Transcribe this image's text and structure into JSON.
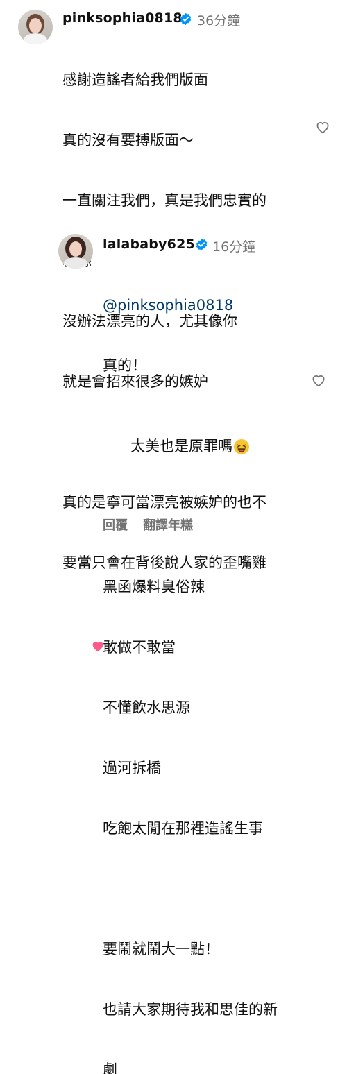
{
  "comment": {
    "username": "pinksophia0818",
    "time": "36分鐘",
    "lines": [
      "感謝造謠者給我們版面",
      "真的沒有要搏版面～",
      "一直關注我們，真是我們忠實的",
      "粉絲",
      "沒辦法漂亮的人，尤其像你",
      "就是會招來很多的嫉妒",
      "",
      "真的是寧可當漂亮被嫉妒的也不",
      "要當只會在背後說人家的歪嘴雞"
    ],
    "end_emoji": "pink-heart-emoji"
  },
  "reply": {
    "username": "lalababy625",
    "time": "16分鐘",
    "mention": "@pinksophia0818",
    "lines": [
      "真的！",
      "太美也是原罪嗎",
      "",
      "黑函爆料臭俗辣",
      "敢做不敢當",
      "不懂飲水思源",
      "過河拆橋",
      "吃飽太閒在那裡造謠生事",
      "",
      "要鬧就鬧大一點！",
      "也請大家期待我和思佳的新",
      "劇"
    ],
    "inline_emoji": "grinning-squinting-face-emoji"
  },
  "actions": {
    "reply_label": "回覆",
    "translate_label": "翻譯年糕"
  },
  "colors": {
    "verified": "#0095f6",
    "secondary_text": "#737373",
    "mention": "#00376b",
    "heart": "#ed4956"
  }
}
